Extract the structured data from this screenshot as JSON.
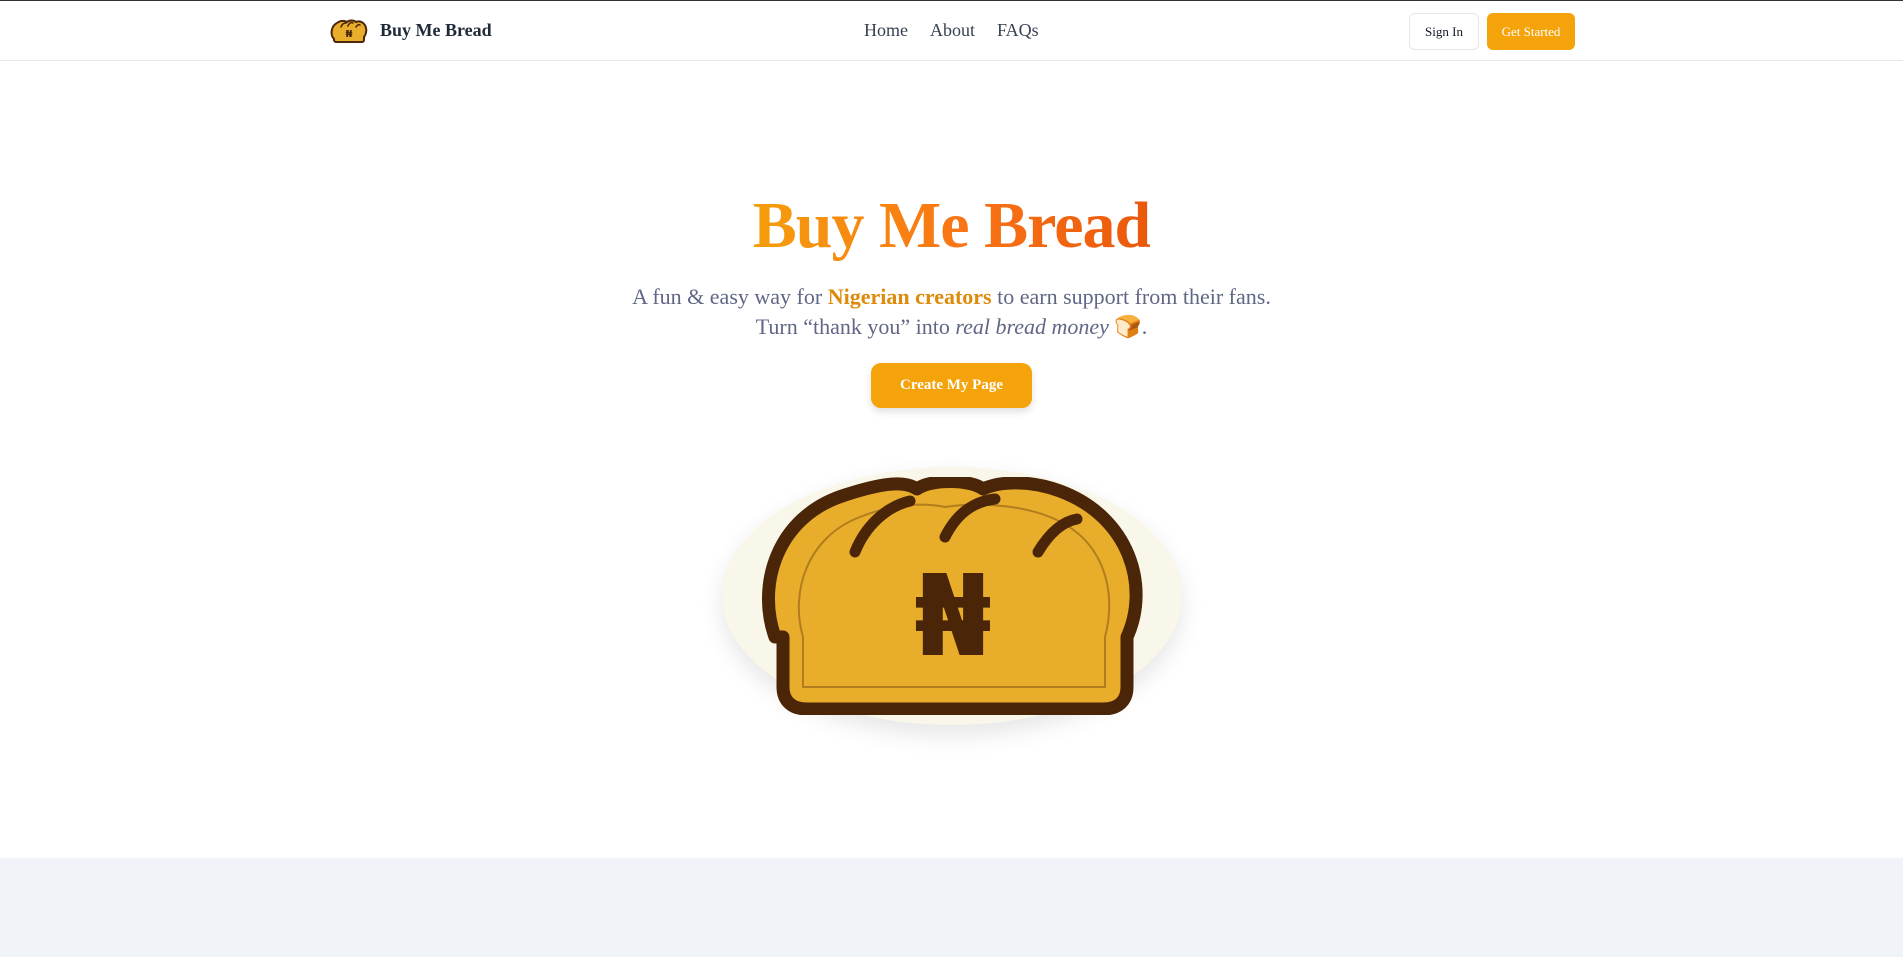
{
  "nav": {
    "brand": "Buy Me Bread",
    "links": [
      "Home",
      "About",
      "FAQs"
    ],
    "sign_in": "Sign In",
    "get_started": "Get Started"
  },
  "hero": {
    "title": "Buy Me Bread",
    "line1_a": "A fun & easy way for ",
    "line1_highlight": "Nigerian creators",
    "line1_b": " to earn support from their fans.",
    "line2_a": "Turn “thank you” into ",
    "line2_em": "real bread money",
    "line2_emoji": "🍞",
    "line2_end": ".",
    "cta": "Create My Page"
  },
  "icons": {
    "logo": "bread-naira-icon",
    "hero": "bread-naira-icon"
  },
  "colors": {
    "accent": "#f5a30b",
    "bread_fill": "#e8ad2a",
    "bread_outline": "#4a2508"
  }
}
